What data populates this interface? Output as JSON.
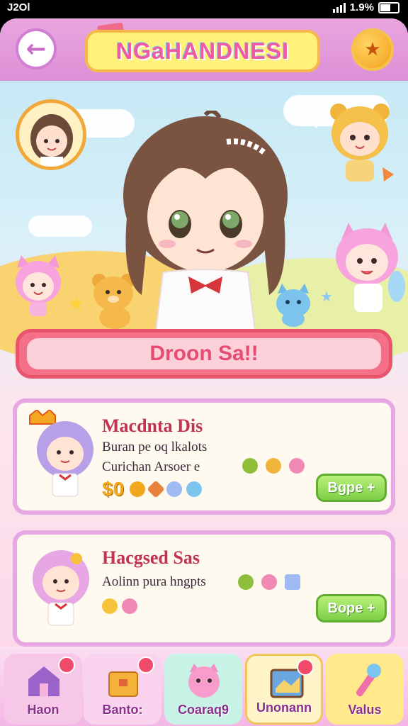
{
  "status_bar": {
    "time": "J2Ol",
    "battery": "1.9%"
  },
  "header": {
    "title": "NGaHANDNESI",
    "back_icon": "back-arrow-icon",
    "coin_icon": "coin-icon"
  },
  "banner": {
    "text": "Droon Sa!!"
  },
  "offers": [
    {
      "name": "Macdnta Dis",
      "line1": "Buran pe oq lkalots",
      "line2": "Curichan Arsoer e",
      "cost": "$0",
      "button": "Bgpe +"
    },
    {
      "name": "Hacgsed Sas",
      "line1": "Aolinn pura hngpts",
      "cost": "",
      "button": "Bope +"
    }
  ],
  "nav": [
    {
      "label": "Haon",
      "icon": "house-icon"
    },
    {
      "label": "Banto:",
      "icon": "chest-icon"
    },
    {
      "label": "Coaraq9",
      "icon": "cat-face-icon"
    },
    {
      "label": "Unonann",
      "icon": "map-icon"
    },
    {
      "label": "Valus",
      "icon": "wand-icon"
    }
  ],
  "colors": {
    "header": "#dd8fd6",
    "title_plate": "#fff17a",
    "banner": "#f47086",
    "buy_button": "#7ccf45"
  }
}
